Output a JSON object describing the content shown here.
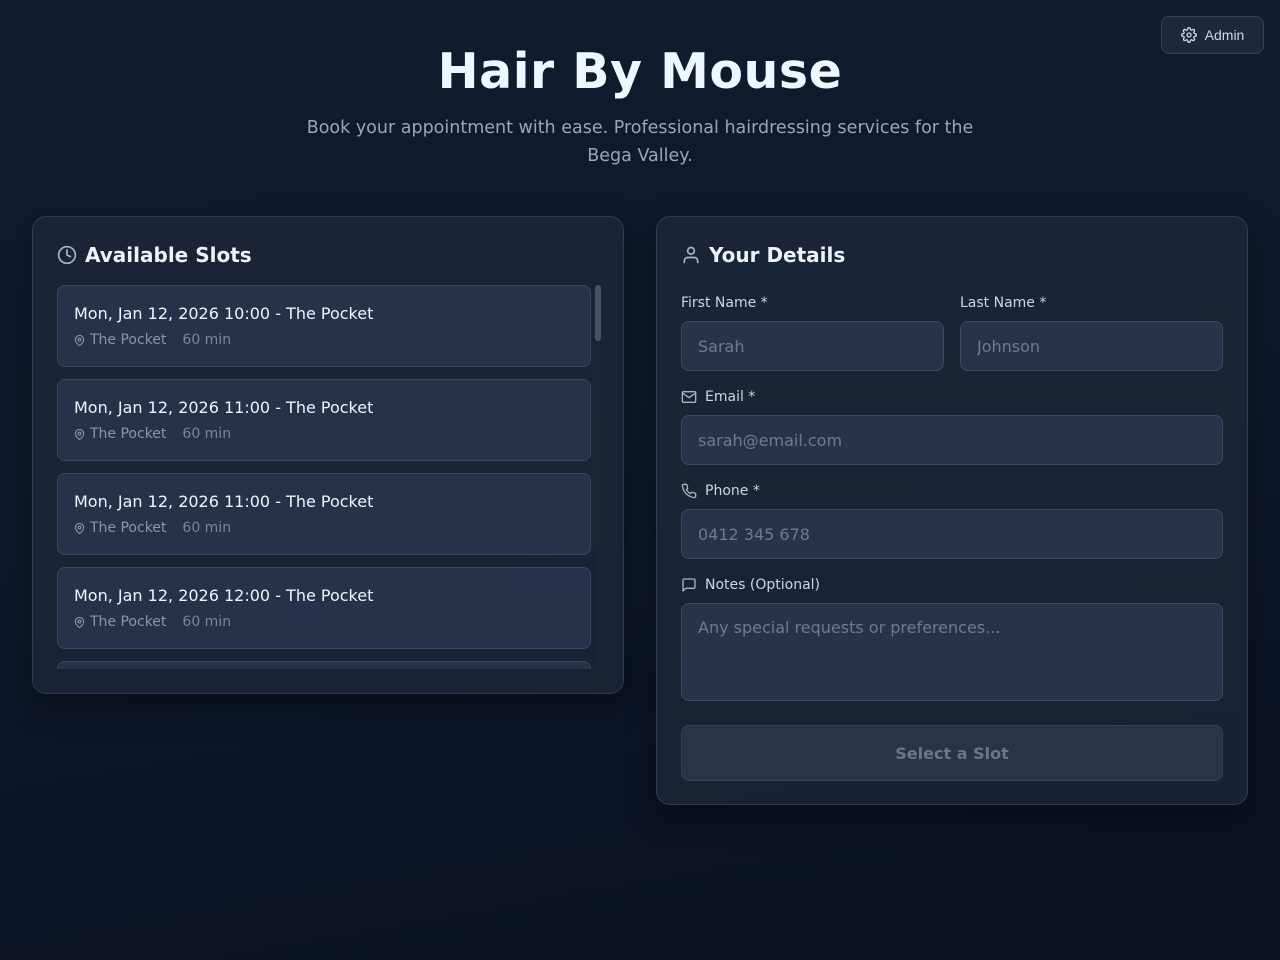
{
  "admin": {
    "label": "Admin",
    "icon": "gear-icon"
  },
  "hero": {
    "title": "Hair By Mouse",
    "subtitle": "Book your appointment with ease. Professional hairdressing services for the Bega Valley."
  },
  "slots": {
    "heading": "Available Slots",
    "icon": "clock-icon",
    "items": [
      {
        "title": "Mon, Jan 12, 2026 10:00 - The Pocket",
        "location": "The Pocket",
        "duration": "60 min"
      },
      {
        "title": "Mon, Jan 12, 2026 11:00 - The Pocket",
        "location": "The Pocket",
        "duration": "60 min"
      },
      {
        "title": "Mon, Jan 12, 2026 11:00 - The Pocket",
        "location": "The Pocket",
        "duration": "60 min"
      },
      {
        "title": "Mon, Jan 12, 2026 12:00 - The Pocket",
        "location": "The Pocket",
        "duration": "60 min"
      }
    ]
  },
  "details": {
    "heading": "Your Details",
    "icon": "user-icon",
    "first_name": {
      "label": "First Name *",
      "placeholder": "Sarah",
      "value": ""
    },
    "last_name": {
      "label": "Last Name *",
      "placeholder": "Johnson",
      "value": ""
    },
    "email": {
      "label": "Email *",
      "placeholder": "sarah@email.com",
      "value": ""
    },
    "phone": {
      "label": "Phone *",
      "placeholder": "0412 345 678",
      "value": ""
    },
    "notes": {
      "label": "Notes (Optional)",
      "placeholder": "Any special requests or preferences...",
      "value": ""
    },
    "submit_label": "Select a Slot"
  }
}
